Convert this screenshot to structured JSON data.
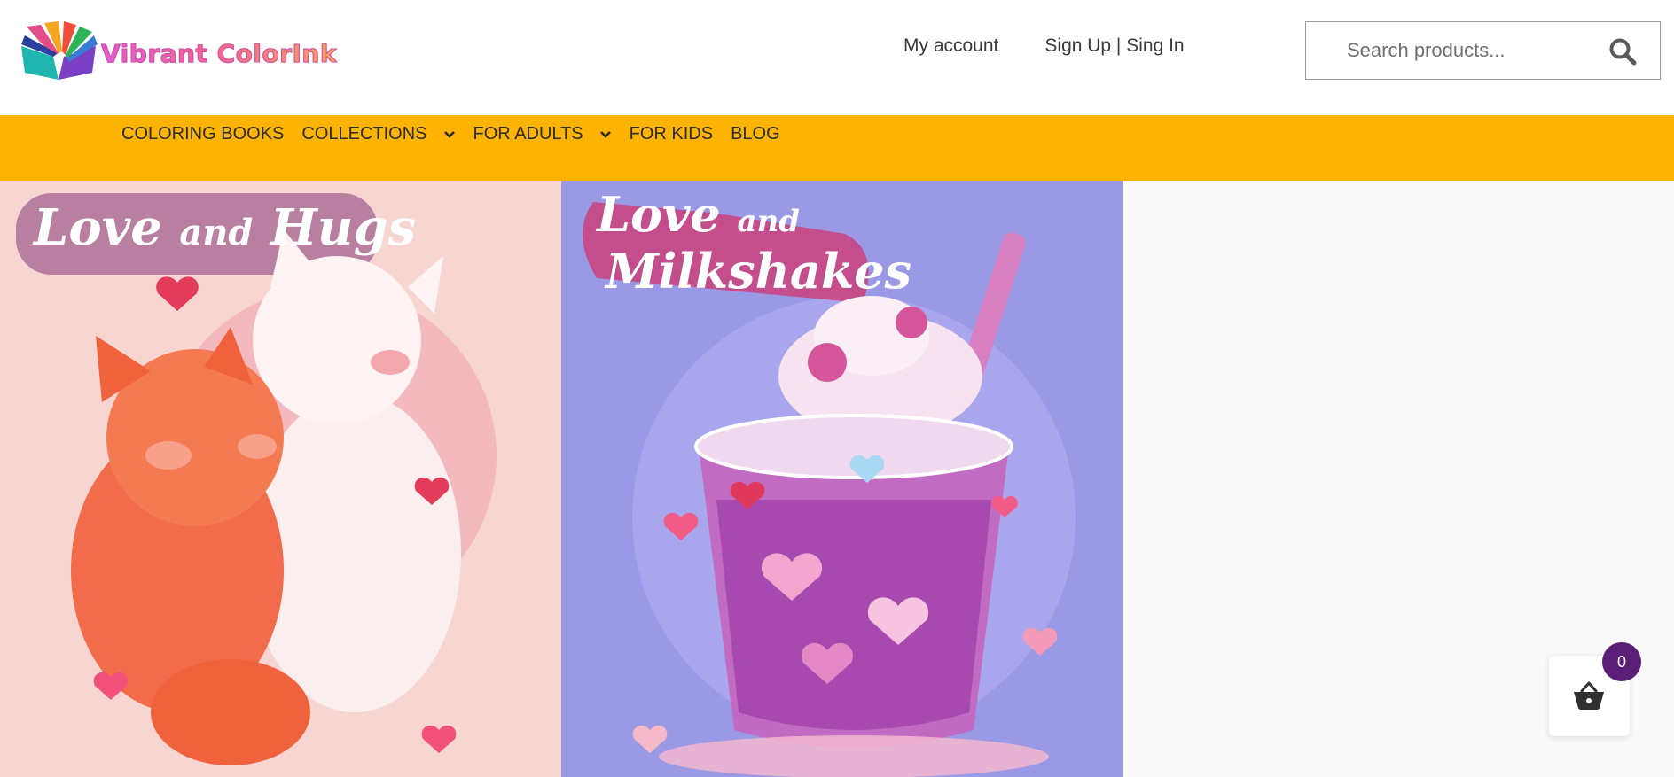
{
  "header": {
    "logo_text": "Vibrant ColorInk",
    "links": {
      "account": "My account",
      "signin": "Sign Up | Sing In"
    },
    "search": {
      "placeholder": "Search products...",
      "icon": "search-icon"
    }
  },
  "nav": {
    "items": [
      {
        "label": "COLORING BOOKS",
        "dropdown": false
      },
      {
        "label": "COLLECTIONS",
        "dropdown": true
      },
      {
        "label": "FOR ADULTS",
        "dropdown": true
      },
      {
        "label": "FOR KIDS",
        "dropdown": false
      },
      {
        "label": "BLOG",
        "dropdown": false
      }
    ],
    "bg_color": "#fdb301"
  },
  "products": [
    {
      "title_line1": "Love",
      "title_and": "and",
      "title_line2": "Hugs"
    },
    {
      "title_line1": "Love",
      "title_and": "and",
      "title_line2": "Milkshakes"
    }
  ],
  "cart": {
    "count": "0",
    "icon": "basket-icon",
    "badge_color": "#5a1e76"
  }
}
